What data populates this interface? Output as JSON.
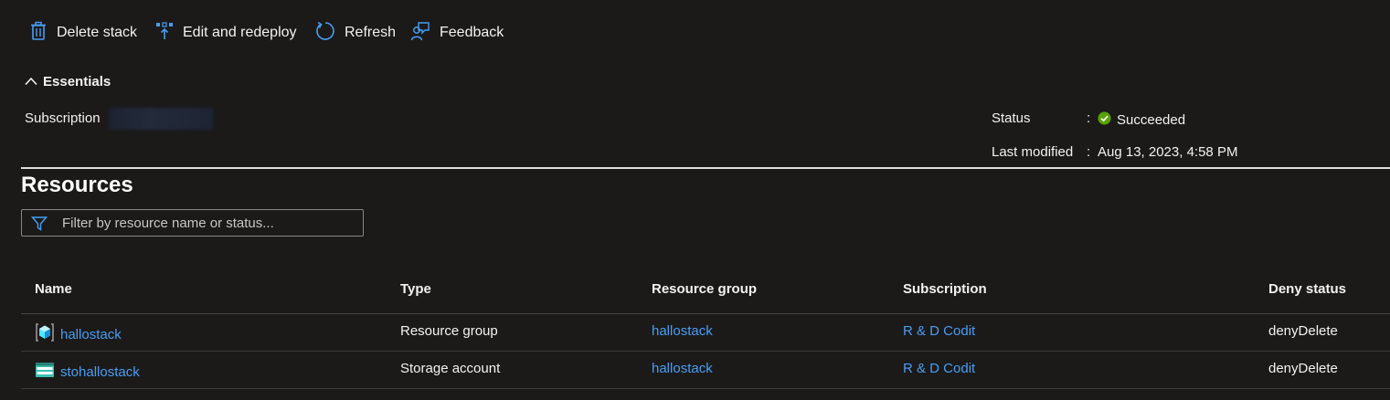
{
  "toolbar": {
    "delete_label": "Delete stack",
    "edit_label": "Edit and redeploy",
    "refresh_label": "Refresh",
    "feedback_label": "Feedback"
  },
  "essentials": {
    "header": "Essentials",
    "subscription_label": "Subscription",
    "status_label": "Status",
    "status_value": "Succeeded",
    "last_modified_label": "Last modified",
    "last_modified_value": "Aug 13, 2023, 4:58 PM",
    "colon": ":"
  },
  "resources": {
    "title": "Resources",
    "filter_placeholder": "Filter by resource name or status...",
    "columns": [
      "Name",
      "Type",
      "Resource group",
      "Subscription",
      "Deny status"
    ],
    "rows": [
      {
        "name": "hallostack",
        "icon": "resource-group-icon",
        "type": "Resource group",
        "resource_group": "hallostack",
        "subscription": "R & D Codit",
        "deny_status": "denyDelete"
      },
      {
        "name": "stohallostack",
        "icon": "storage-account-icon",
        "type": "Storage account",
        "resource_group": "hallostack",
        "subscription": "R & D Codit",
        "deny_status": "denyDelete"
      }
    ]
  },
  "colors": {
    "accent": "#479ef5",
    "success": "#57a300",
    "background": "#1b1a19"
  }
}
